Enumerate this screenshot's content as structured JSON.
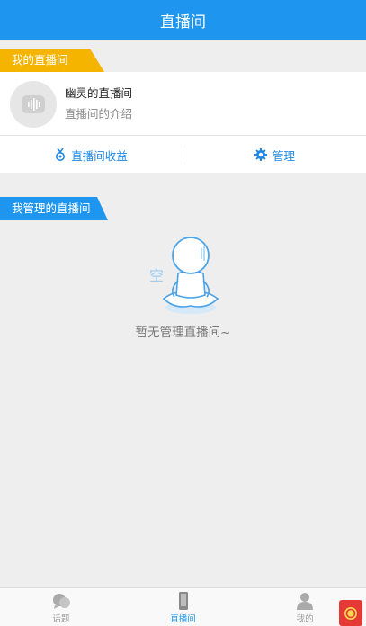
{
  "header": {
    "title": "直播间"
  },
  "my_rooms": {
    "section_label": "我的直播间",
    "room": {
      "name": "幽灵的直播间",
      "description": "直播间的介绍"
    },
    "actions": [
      {
        "label": "直播间收益",
        "icon": "medal-icon"
      },
      {
        "label": "管理",
        "icon": "gear-icon"
      }
    ]
  },
  "managed_rooms": {
    "section_label": "我管理的直播间",
    "empty_text": "暂无管理直播间~",
    "empty_illustration_text": "空"
  },
  "tabbar": {
    "tabs": [
      {
        "label": "话题",
        "icon": "chat-bubbles-icon",
        "active": false
      },
      {
        "label": "直播间",
        "icon": "phone-icon",
        "active": true
      },
      {
        "label": "我的",
        "icon": "person-icon",
        "active": false
      }
    ]
  },
  "colors": {
    "primary": "#1e96f0",
    "orange": "#f5b400",
    "background": "#eeeeee",
    "badge": "#e53935"
  }
}
